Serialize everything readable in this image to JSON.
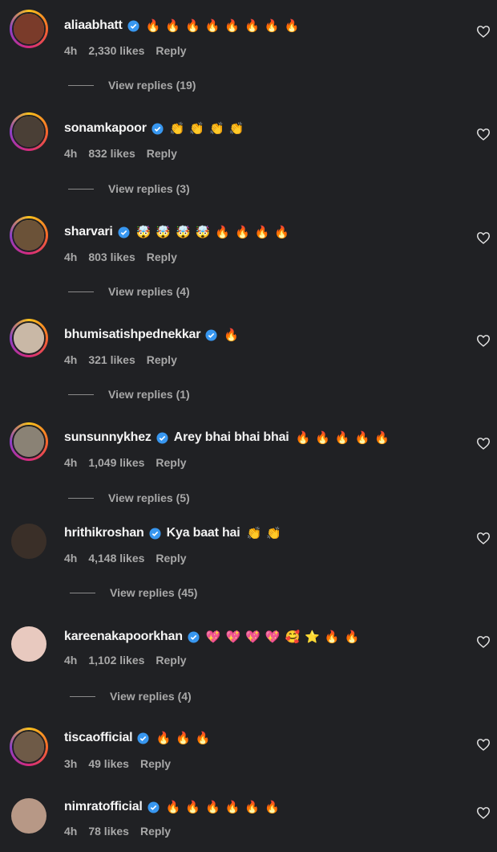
{
  "comments": [
    {
      "username": "aliaabhatt",
      "text": "",
      "emojis": "🔥🔥🔥🔥🔥🔥🔥🔥",
      "time": "4h",
      "likes": "2,330 likes",
      "reply": "Reply",
      "view_replies": "View replies (19)",
      "avatar_color": "#7a3b2a"
    },
    {
      "username": "sonamkapoor",
      "text": "",
      "emojis": "👏👏👏👏",
      "time": "4h",
      "likes": "832 likes",
      "reply": "Reply",
      "view_replies": "View replies (3)",
      "avatar_color": "#4a3f36"
    },
    {
      "username": "sharvari",
      "text": "",
      "emojis": "🤯🤯🤯🤯🔥🔥🔥🔥",
      "time": "4h",
      "likes": "803 likes",
      "reply": "Reply",
      "view_replies": "View replies (4)",
      "avatar_color": "#6b5238"
    },
    {
      "username": "bhumisatishpednekkar",
      "text": "",
      "emojis": "🔥",
      "time": "4h",
      "likes": "321 likes",
      "reply": "Reply",
      "view_replies": "View replies (1)",
      "avatar_color": "#c9b8a6"
    },
    {
      "username": "sunsunnykhez",
      "text": "Arey bhai bhai bhai",
      "emojis": "🔥🔥🔥🔥🔥",
      "time": "4h",
      "likes": "1,049 likes",
      "reply": "Reply",
      "view_replies": "View replies (5)",
      "avatar_color": "#8a8275"
    },
    {
      "username": "hrithikroshan",
      "text": "Kya baat hai",
      "emojis": "👏👏",
      "time": "4h",
      "likes": "4,148 likes",
      "reply": "Reply",
      "view_replies": "View replies (45)",
      "avatar_color": "#3a2f28"
    },
    {
      "username": "kareenakapoorkhan",
      "text": "",
      "emojis": "💖💖💖💖🥰⭐🔥🔥",
      "time": "4h",
      "likes": "1,102 likes",
      "reply": "Reply",
      "view_replies": "View replies (4)",
      "avatar_color": "#e8c9bf"
    },
    {
      "username": "tiscaofficial",
      "text": "",
      "emojis": "🔥🔥🔥",
      "time": "3h",
      "likes": "49 likes",
      "reply": "Reply",
      "view_replies": "",
      "avatar_color": "#6e5a47"
    },
    {
      "username": "nimratofficial",
      "text": "",
      "emojis": "🔥🔥🔥🔥🔥🔥",
      "time": "4h",
      "likes": "78 likes",
      "reply": "Reply",
      "view_replies": "",
      "avatar_color": "#b79886"
    }
  ],
  "colors": {
    "background": "#202124",
    "verified": "#3897f0",
    "muted": "#a8a8a8"
  },
  "icons": {
    "verified": "verified-badge-icon",
    "like": "heart-outline-icon"
  }
}
